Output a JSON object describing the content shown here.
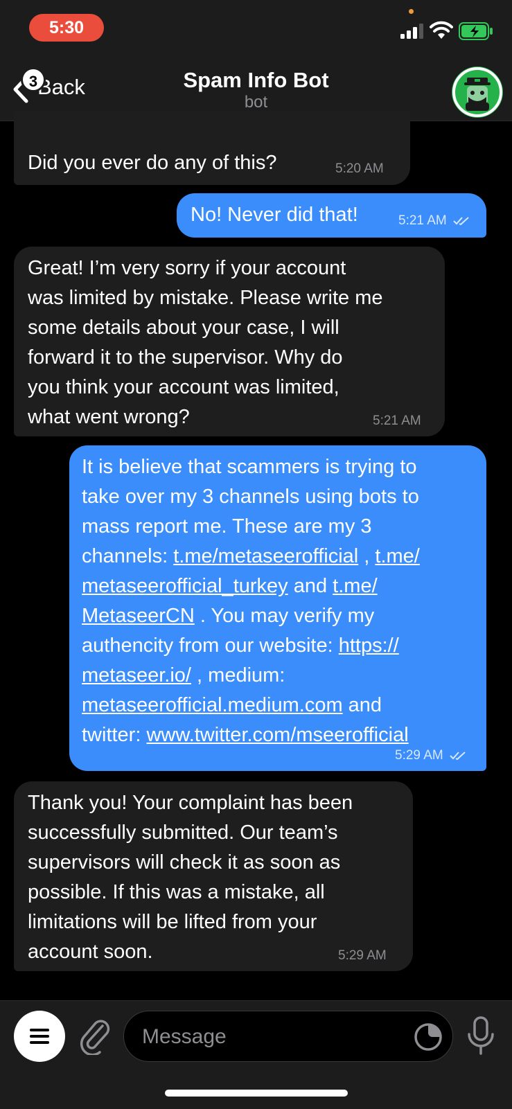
{
  "status_bar": {
    "time": "5:30"
  },
  "header": {
    "back_label": "Back",
    "unread_count": "3",
    "title": "Spam Info Bot",
    "subtitle": "bot"
  },
  "messages": [
    {
      "direction": "incoming",
      "lines": [
        "Did you ever do any of this?"
      ],
      "time": "5:20 AM"
    },
    {
      "direction": "outgoing",
      "lines": [
        "No! Never did that!"
      ],
      "time": "5:21 AM",
      "read": true
    },
    {
      "direction": "incoming",
      "lines": [
        "Great! I’m very sorry if your account",
        "was limited by mistake. Please write me",
        "some details about your case, I will",
        "forward it to the supervisor. Why do",
        "you think your account was limited,",
        "what went wrong?"
      ],
      "time": "5:21 AM"
    },
    {
      "direction": "outgoing",
      "l1": "It is believe that scammers is trying to",
      "l2": "take over my 3 channels using bots to",
      "l3": "mass report me. These are my 3",
      "l4_a": "channels: ",
      "l4_link1": "t.me/metaseerofficial",
      "l4_b": " , ",
      "l4_link2": "t.me/",
      "l5_link": "metaseerofficial_turkey",
      "l5_b": " and ",
      "l5_link2": "t.me/",
      "l6_link": "MetaseerCN",
      "l6_b": " . You may verify my",
      "l7_a": "authencity from our website: ",
      "l7_link": "https://",
      "l8_link": "metaseer.io/",
      "l8_b": " , medium:",
      "l9_link": "metaseerofficial.medium.com",
      "l9_b": " and",
      "l10_a": "twitter: ",
      "l10_link": "www.twitter.com/mseerofficial",
      "time": "5:29 AM",
      "read": true
    },
    {
      "direction": "incoming",
      "lines": [
        "Thank you! Your complaint has been",
        "successfully submitted. Our team’s",
        "supervisors will check it as soon as",
        "possible. If this was a mistake, all",
        "limitations will be lifted from your",
        "account soon."
      ],
      "time": "5:29 AM"
    }
  ],
  "composer": {
    "placeholder": "Message"
  },
  "icons": {
    "back": "chevron-left-icon",
    "avatar": "bot-avatar-icon",
    "menu": "menu-icon",
    "attach": "paperclip-icon",
    "sticker": "sticker-icon",
    "mic": "microphone-icon",
    "read_receipt": "double-check-icon"
  },
  "colors": {
    "outgoing_bubble": "#3a8dfb",
    "incoming_bubble": "#1e1e1e",
    "time_pill": "#eb4d3d",
    "avatar_bg": "#26b24b",
    "battery": "#34c759"
  }
}
